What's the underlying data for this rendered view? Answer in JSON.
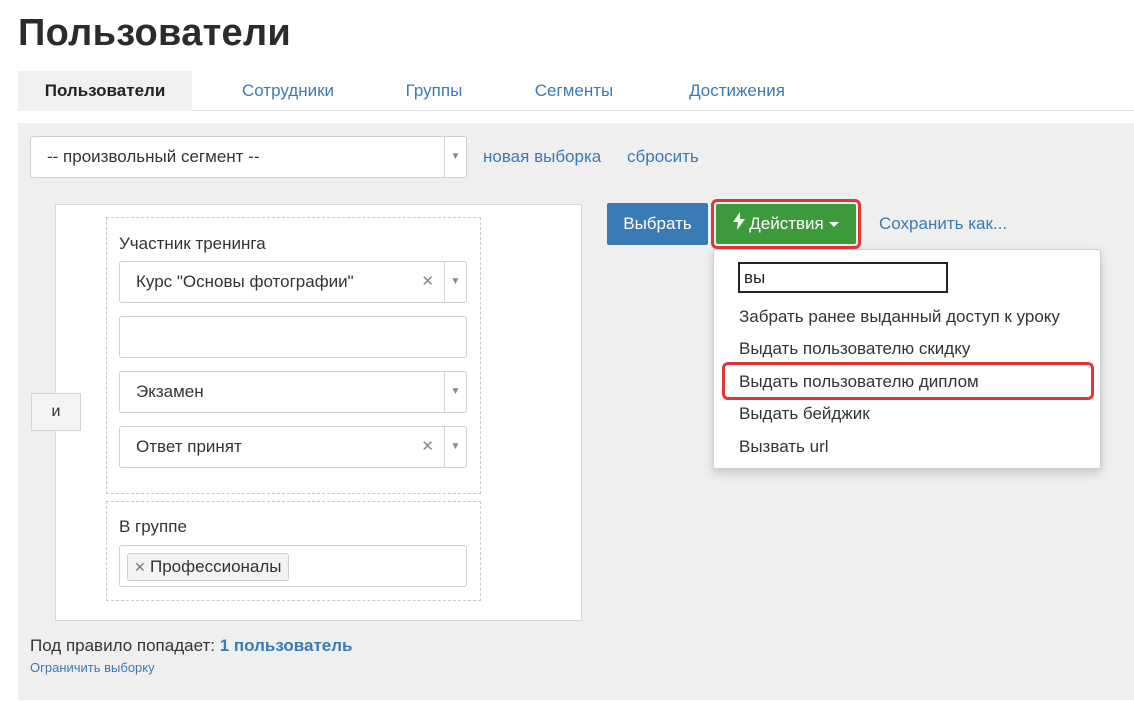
{
  "page": {
    "title": "Пользователи"
  },
  "tabs": [
    {
      "label": "Пользователи",
      "active": true
    },
    {
      "label": "Сотрудники"
    },
    {
      "label": "Группы"
    },
    {
      "label": "Сегменты"
    },
    {
      "label": "Достижения"
    }
  ],
  "segment": {
    "selected": "-- произвольный сегмент --",
    "new_link": "новая выборка",
    "reset_link": "сбросить"
  },
  "rule": {
    "operator": "и",
    "group1": {
      "label": "Участник тренинга",
      "course_value": "Курс \"Основы фотографии\"",
      "exam_value": "Экзамен",
      "status_value": "Ответ принят"
    },
    "group2": {
      "label": "В группе",
      "tag": "Профессионалы"
    }
  },
  "buttons": {
    "select": "Выбрать",
    "actions": "Действия",
    "save_as": "Сохранить как..."
  },
  "actions_menu": {
    "search_value": "вы",
    "items": [
      "Забрать ранее выданный доступ к уроку",
      "Выдать пользователю скидку",
      "Выдать пользователю диплом",
      "Выдать бейджик",
      "Вызвать url"
    ]
  },
  "footer": {
    "result_prefix": "Под правило попадает:",
    "result_count": "1 пользователь",
    "limit_link": "Ограничить выборку"
  },
  "colors": {
    "accent_blue": "#3a7ab7",
    "action_green": "#3d9a3a",
    "highlight_red": "#e0363b",
    "panel_bg": "#efefef"
  }
}
